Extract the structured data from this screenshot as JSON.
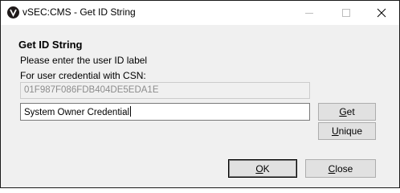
{
  "window": {
    "title": "vSEC:CMS - Get ID String",
    "app_icon": "vsec-logo-icon",
    "controls": [
      "minimize-icon",
      "maximize-icon",
      "close-icon"
    ]
  },
  "dialog": {
    "heading": "Get ID String",
    "prompt": "Please enter the user ID label",
    "csn_label": "For user credential with CSN:",
    "csn_value": "01F987F086FDB404DE5EDA1E",
    "id_value": "System Owner Credential"
  },
  "buttons": {
    "get": {
      "mnemonic": "G",
      "rest": "et"
    },
    "unique": {
      "mnemonic": "U",
      "rest": "nique"
    },
    "ok": {
      "mnemonic": "O",
      "rest": "K"
    },
    "close": {
      "mnemonic": "C",
      "rest": "lose"
    }
  }
}
